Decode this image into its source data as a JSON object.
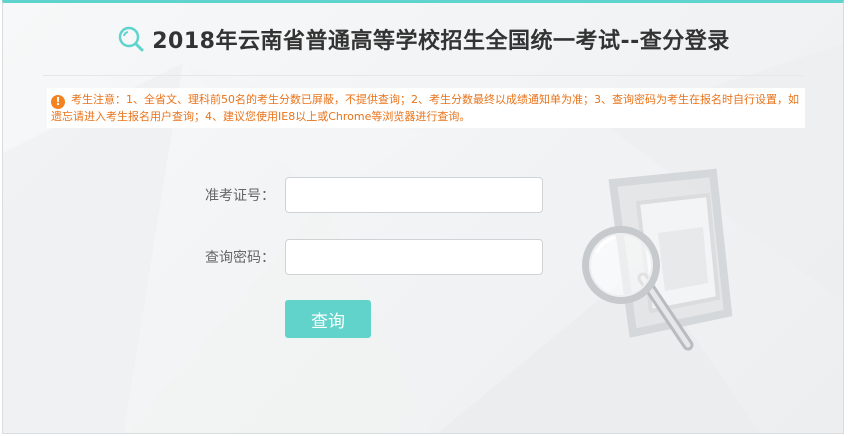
{
  "header": {
    "title": "2018年云南省普通高等学校招生全国统一考试--查分登录",
    "icon": "search-icon"
  },
  "notice": {
    "icon": "exclamation-icon",
    "text": "考生注意：1、全省文、理科前50名的考生分数已屏蔽，不提供查询；2、考生分数最终以成绩通知单为准；3、查询密码为考生在报名时自行设置，如遗忘请进入考生报名用户查询；4、建议您使用IE8以上或Chrome等浏览器进行查询。"
  },
  "form": {
    "exam_id_label": "准考证号：",
    "exam_id_value": "",
    "password_label": "查询密码：",
    "password_value": "",
    "submit_label": "查询"
  },
  "colors": {
    "accent": "#62d3cb",
    "warning": "#e8731a"
  },
  "decoration": "magnifier-over-documents-illustration"
}
